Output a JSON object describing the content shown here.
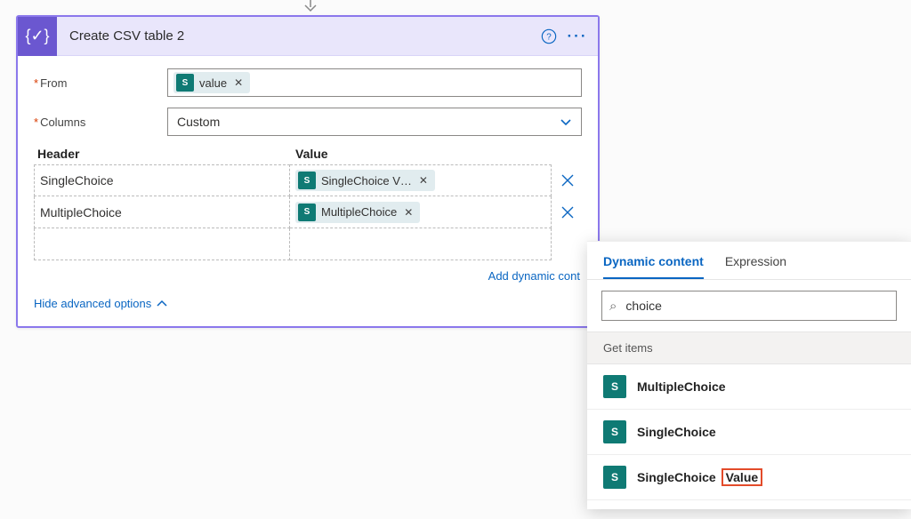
{
  "action": {
    "title": "Create CSV table 2",
    "fields": {
      "from_label": "From",
      "columns_label": "Columns",
      "columns_value": "Custom",
      "header_heading": "Header",
      "value_heading": "Value"
    },
    "from_token": {
      "label": "value"
    },
    "rows": [
      {
        "header": "SingleChoice",
        "value_token": "SingleChoice V…"
      },
      {
        "header": "MultipleChoice",
        "value_token": "MultipleChoice"
      }
    ],
    "add_dynamic_label": "Add dynamic cont",
    "hide_advanced_label": "Hide advanced options"
  },
  "dynamic_panel": {
    "tabs": {
      "dynamic": "Dynamic content",
      "expression": "Expression"
    },
    "search_value": "choice",
    "section_label": "Get items",
    "items": [
      {
        "label_full": "MultipleChoice",
        "highlight_suffix": ""
      },
      {
        "label_full": "SingleChoice",
        "highlight_suffix": ""
      },
      {
        "label_prefix": "SingleChoice",
        "highlight_suffix": "Value"
      }
    ]
  },
  "icons": {
    "action_badge_glyph": "{✓}",
    "sp_glyph": "S",
    "search_glyph": "⌕"
  }
}
